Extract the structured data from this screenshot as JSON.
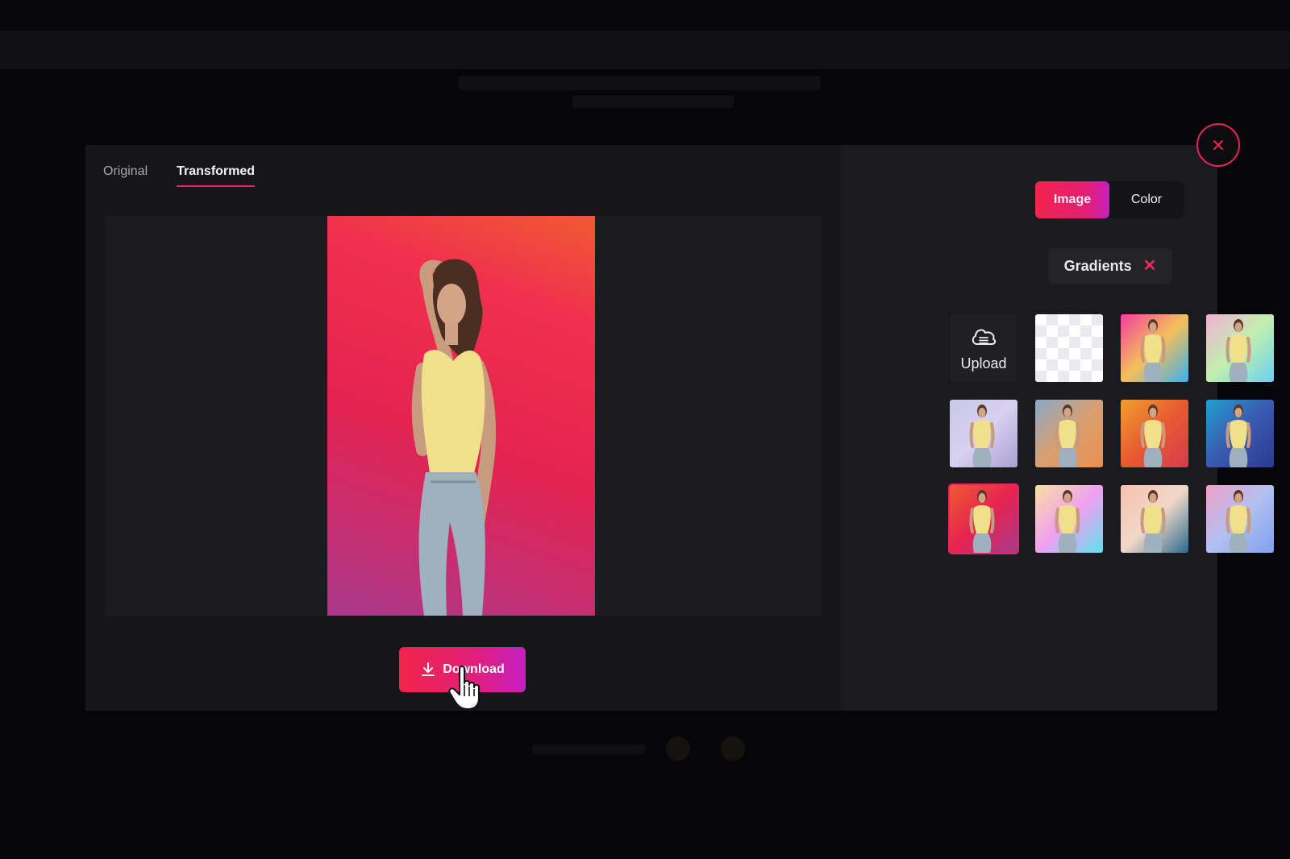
{
  "preview_tabs": [
    {
      "label": "Original",
      "active": false
    },
    {
      "label": "Transformed",
      "active": true
    }
  ],
  "actions": {
    "download_label": "Download"
  },
  "background_panel": {
    "modes": [
      {
        "label": "Image",
        "active": true
      },
      {
        "label": "Color",
        "active": false
      }
    ],
    "filter": {
      "label": "Gradients"
    },
    "upload_label": "Upload",
    "swatches": [
      {
        "kind": "transparent"
      },
      {
        "kind": "gradient",
        "colors": [
          "#f03ea0",
          "#f6c05a",
          "#3ab0f0"
        ]
      },
      {
        "kind": "gradient",
        "colors": [
          "#f3b0d4",
          "#c0f0b0",
          "#6ad0f0"
        ]
      },
      {
        "kind": "gradient",
        "colors": [
          "#c8c8e8",
          "#d8d0f0",
          "#a8a0d0"
        ]
      },
      {
        "kind": "gradient",
        "colors": [
          "#8aa8c8",
          "#d8a070",
          "#e89050"
        ]
      },
      {
        "kind": "gradient",
        "colors": [
          "#f0a030",
          "#e85a30",
          "#d83a50"
        ]
      },
      {
        "kind": "gradient",
        "colors": [
          "#20a0d0",
          "#3a5ab0",
          "#2a3a90"
        ]
      },
      {
        "kind": "gradient",
        "colors": [
          "#f05a32",
          "#e52350",
          "#a83a8c"
        ],
        "selected": true
      },
      {
        "kind": "gradient",
        "colors": [
          "#f8e0a0",
          "#f0a0f0",
          "#60e0f0"
        ]
      },
      {
        "kind": "gradient",
        "colors": [
          "#f8c0b0",
          "#f0d8c8",
          "#2a6a90"
        ]
      },
      {
        "kind": "gradient",
        "colors": [
          "#f0a0c8",
          "#b0c0f0",
          "#80a0f0"
        ]
      }
    ]
  },
  "colors": {
    "accent": "#e8265a",
    "accent_purple": "#c61fc4",
    "modal_bg": "#141417"
  }
}
